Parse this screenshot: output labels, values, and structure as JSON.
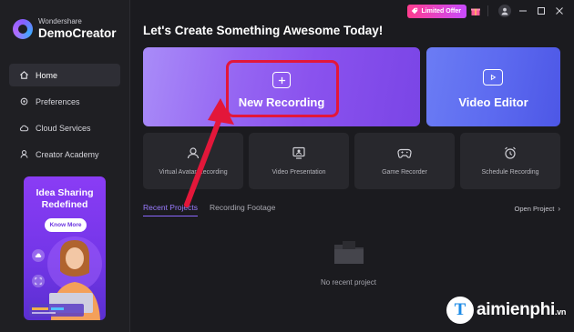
{
  "app": {
    "brand_small": "Wondershare",
    "brand_main": "DemoCreator"
  },
  "sidebar": {
    "items": [
      {
        "label": "Home",
        "icon": "home-icon",
        "active": true
      },
      {
        "label": "Preferences",
        "icon": "settings-icon",
        "active": false
      },
      {
        "label": "Cloud Services",
        "icon": "cloud-icon",
        "active": false
      },
      {
        "label": "Creator Academy",
        "icon": "academy-icon",
        "active": false
      }
    ],
    "promo": {
      "title_line1": "Idea Sharing",
      "title_line2": "Redefined",
      "button": "Know More"
    }
  },
  "topbar": {
    "offer_label": "Limited Offer"
  },
  "main": {
    "heading": "Let's Create Something Awesome Today!",
    "primary_cards": [
      {
        "label": "New Recording",
        "icon": "plus-icon"
      },
      {
        "label": "Video Editor",
        "icon": "play-icon"
      }
    ],
    "tiles": [
      {
        "label": "Virtual Avatar Recording",
        "icon": "avatar-icon"
      },
      {
        "label": "Video Presentation",
        "icon": "presentation-icon"
      },
      {
        "label": "Game Recorder",
        "icon": "gamepad-icon"
      },
      {
        "label": "Schedule Recording",
        "icon": "alarm-clock-icon"
      }
    ],
    "tabs": [
      {
        "label": "Recent Projects",
        "active": true
      },
      {
        "label": "Recording Footage",
        "active": false
      }
    ],
    "open_project": "Open Project",
    "empty_state": "No recent project"
  },
  "watermark": {
    "text": "aimienphi",
    "suffix": ".vn",
    "mark": "T"
  },
  "colors": {
    "accent": "#8b68ff",
    "highlight": "#e3173a",
    "background": "#1b1b1f"
  }
}
